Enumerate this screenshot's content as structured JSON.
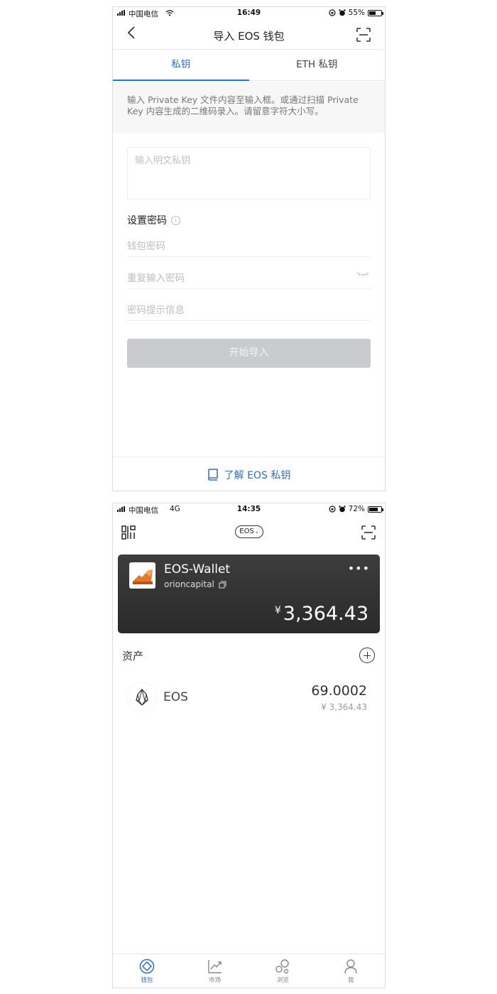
{
  "screen1": {
    "status": {
      "carrier": "中国电信",
      "time": "16:49",
      "battery": "55%",
      "battery_level": 0.55
    },
    "nav": {
      "title": "导入 EOS 钱包"
    },
    "tabs": [
      {
        "label": "私钥"
      },
      {
        "label": "ETH 私钥"
      }
    ],
    "hint": "输入 Private Key 文件内容至输入框。或通过扫描 Private Key 内容生成的二维码录入。请留意字符大小写。",
    "key_placeholder": "输入明文私钥",
    "password_section": "设置密码",
    "fields": {
      "password": "钱包密码",
      "repeat": "重复输入密码",
      "hint": "密码提示信息"
    },
    "start_button": "开始导入",
    "learn_link": "了解 EOS 私钥"
  },
  "screen2": {
    "status": {
      "carrier": "中国电信",
      "network": "4G",
      "time": "14:35",
      "battery": "72%",
      "battery_level": 0.72
    },
    "chain_selector": "EOS",
    "wallet": {
      "name": "EOS-Wallet",
      "account": "orioncapital",
      "currency_symbol": "¥",
      "total": "3,364.43"
    },
    "assets_title": "资产",
    "assets": [
      {
        "symbol": "EOS",
        "amount": "69.0002",
        "fiat": "¥ 3,364.43"
      }
    ],
    "tabbar": [
      {
        "label": "钱包"
      },
      {
        "label": "市场"
      },
      {
        "label": "浏览"
      },
      {
        "label": "我"
      }
    ],
    "colors": {
      "accent": "#2f6fba",
      "card": "#333333",
      "disabled": "#c9cbce"
    }
  }
}
